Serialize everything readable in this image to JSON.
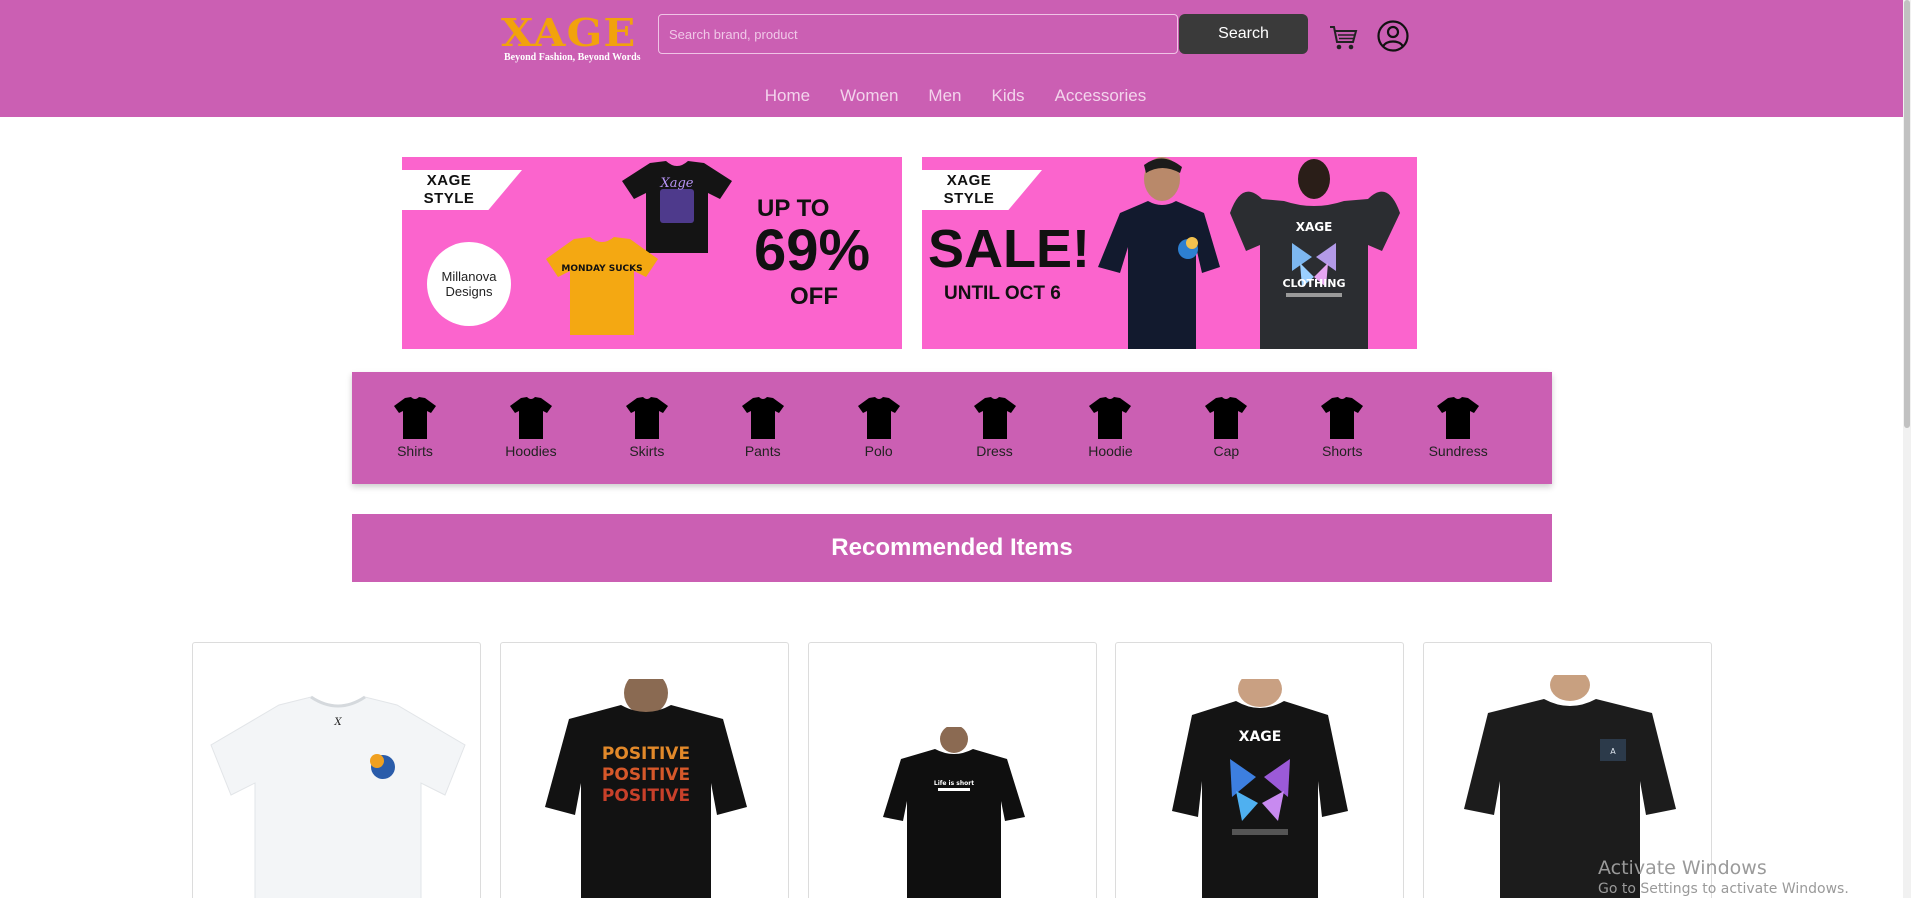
{
  "header": {
    "logo": "XAGE",
    "tagline": "Beyond Fashion, Beyond Words",
    "search_placeholder": "Search brand, product",
    "search_label": "Search",
    "bg_color": "#cb5fb3",
    "logo_color": "#f2a20c",
    "cart_icon": "cart-icon",
    "user_icon": "user-icon"
  },
  "nav": [
    "Home",
    "Women",
    "Men",
    "Kids",
    "Accessories"
  ],
  "banners": [
    {
      "tag_line1": "XAGE",
      "tag_line2": "STYLE",
      "circle_text": "Millanova Designs",
      "shirt1_text": "Xage",
      "shirt2_text": "MONDAY SUCKS",
      "up_to": "UP TO",
      "percent": "69%",
      "off": "OFF"
    },
    {
      "tag_line1": "XAGE",
      "tag_line2": "STYLE",
      "sale": "SALE!",
      "until": "UNTIL OCT 6",
      "shirt_text1": "XAGE",
      "shirt_text2": "CLOTHING"
    }
  ],
  "categories": [
    "Shirts",
    "Hoodies",
    "Skirts",
    "Pants",
    "Polo",
    "Dress",
    "Hoodie",
    "Cap",
    "Shorts",
    "Sundress"
  ],
  "recommended_title": "Recommended Items",
  "products": [
    {
      "color": "white",
      "print": ""
    },
    {
      "color": "black",
      "print": "POSITIVE"
    },
    {
      "color": "black",
      "print": "Life is short"
    },
    {
      "color": "black",
      "print": "XAGE"
    },
    {
      "color": "black",
      "print": ""
    }
  ],
  "watermark": {
    "line1": "Activate Windows",
    "line2": "Go to Settings to activate Windows."
  }
}
